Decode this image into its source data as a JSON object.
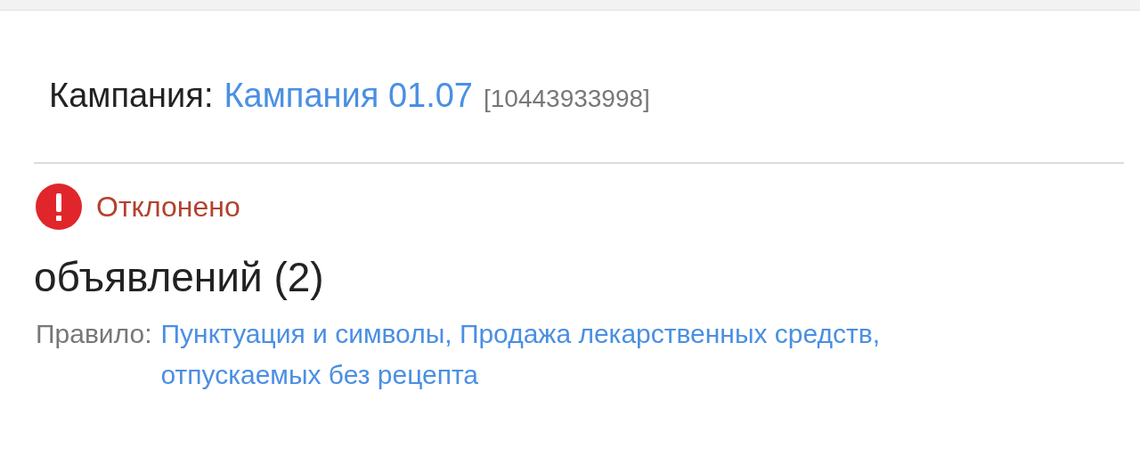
{
  "campaign": {
    "label": "Кампания:",
    "name": "Кампания 01.07",
    "id": "[10443933998]"
  },
  "status": {
    "kind": "rejected",
    "label": "Отклонено"
  },
  "heading": "объявлений (2)",
  "rule": {
    "label": "Правило:",
    "value": "Пунктуация и символы, Продажа лекарственных средств, отпускаемых без рецепта"
  }
}
